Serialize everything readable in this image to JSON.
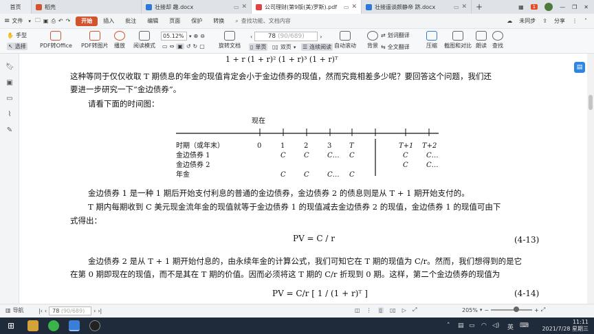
{
  "tabs": {
    "home": "首页",
    "items": [
      {
        "title": "稻壳",
        "color": "#d2542f"
      },
      {
        "title": "壮接却 趣.docx",
        "color": "#2b79d8"
      },
      {
        "title": "公司理财(第9版(美)罗斯).pdf",
        "color": "#e04545"
      },
      {
        "title": "壮接遥谈颜静帝 跻.docx",
        "color": "#2b79d8"
      }
    ],
    "new_tab": "+",
    "badge": "1"
  },
  "menu": {
    "file": "文件",
    "items": [
      "开始",
      "插入",
      "批注",
      "编辑",
      "页面",
      "保护",
      "转换"
    ],
    "active": "开始",
    "search": "查找功能、文档内容",
    "sync": "未同步",
    "share": "分享"
  },
  "toolbar": {
    "hand": "手型",
    "select": "选择",
    "pdf_office": "PDF转Office",
    "pdf_img": "PDF转图片",
    "play": "播放",
    "read_mode": "阅读模式",
    "zoom": "05.12%",
    "rotate": "旋转文档",
    "single": "单页",
    "double": "双页",
    "continuous": "连续阅读",
    "auto_scroll": "自动滚动",
    "page_current": "78",
    "page_total": "(90/689)",
    "background": "背景",
    "word_translate": "划词翻译",
    "full_translate": "全文翻译",
    "compress": "压缩",
    "screenshot": "截图和对比",
    "read_aloud": "朗读",
    "find": "查找"
  },
  "document": {
    "top_formula": "1 + r     (1 + r)²     (1 + r)³            (1 + r)ᵀ",
    "para1a": "这种等同于仅仅收取 T 期债息的年金的现值肯定会小于金边债券的现值，然而究竟相差多少呢？要回答这个问题，我们还",
    "para1b": "要进一步研究一下“金边债券”。",
    "para2": "请看下面的时间图：",
    "timeline": {
      "now_label": "现在",
      "ticks": [
        "0",
        "1",
        "2",
        "3",
        "T",
        "T+1",
        "T+2"
      ],
      "row_labels": [
        "时期（或年末）",
        "金边债券 1",
        "金边债券 2",
        "年金"
      ],
      "row1": [
        "C",
        "C",
        "C…",
        "C",
        "C",
        "C…"
      ],
      "row2": [
        "C",
        "C…"
      ],
      "row3": [
        "C",
        "C",
        "C…",
        "C"
      ]
    },
    "para3": "金边债券 1 是一种 1 期后开始支付利息的普通的金边债券，金边债券 2 的债息则是从 T + 1 期开始支付的。",
    "para4a": "T 期内每期收到 C 美元现金流年金的现值就等于金边债券 1 的现值减去金边债券 2 的现值，金边债券 1 的现值可由下",
    "para4b": "式得出：",
    "eq1": "PV = C / r",
    "eq1_num": "(4-13)",
    "para5a": "金边债券 2 是从 T + 1 期开始付息的，由永续年金的计算公式，我们可知它在 T 期的现值为 C/r。然而，我们想得到的是它",
    "para5b": "在第 0 期即现在的现值，而不是其在 T 期的价值。因而必须将这 T 期的 C/r 折现到 0 期。这样，第二个金边债券的现值为",
    "eq2": "PV = C/r [ 1 / (1 + r)ᵀ ]",
    "eq2_num": "(4-14)"
  },
  "statusbar": {
    "nav": "导航",
    "page": "78",
    "page_total": "(90/689)",
    "zoom": "205%",
    "zoom_fraction": 0.62
  },
  "taskbar": {
    "time": "11:11",
    "date": "2021/7/28 星期三",
    "lang": "英"
  },
  "colors": {
    "accent": "#d2542f",
    "taskbar": "#1f2a3a",
    "blue": "#2b79d8"
  }
}
